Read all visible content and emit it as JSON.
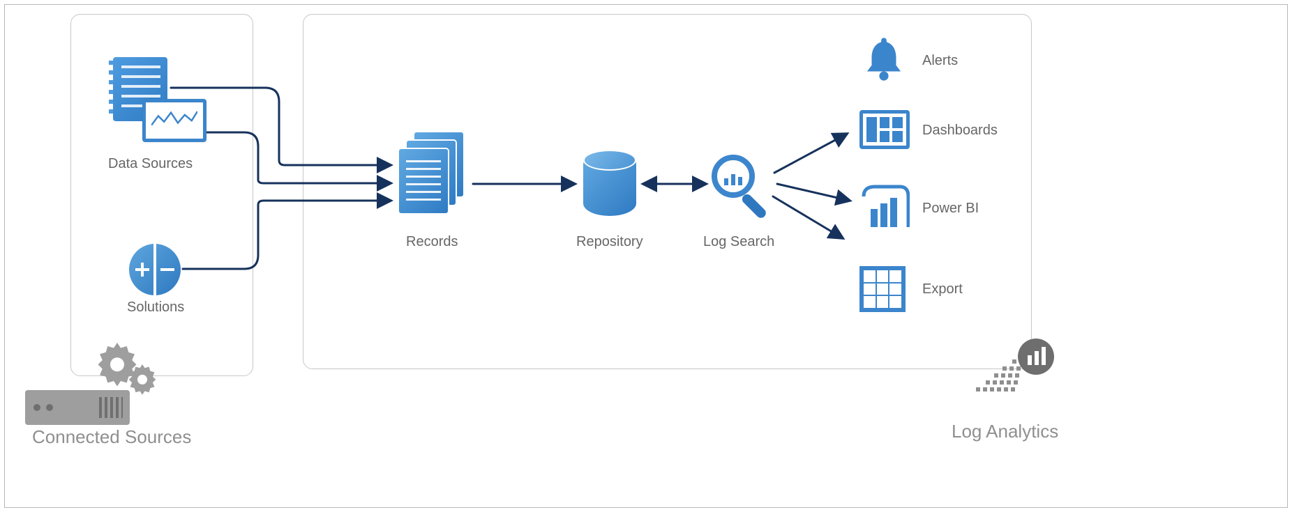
{
  "sources_panel": {
    "data_sources_label": "Data Sources",
    "solutions_label": "Solutions",
    "connected_sources_label": "Connected Sources"
  },
  "pipeline": {
    "records_label": "Records",
    "repository_label": "Repository",
    "log_search_label": "Log Search"
  },
  "outputs": {
    "alerts_label": "Alerts",
    "dashboards_label": "Dashboards",
    "powerbi_label": "Power BI",
    "export_label": "Export"
  },
  "branding": {
    "log_analytics_label": "Log Analytics"
  },
  "colors": {
    "primary_blue": "#3b85cc",
    "dark_navy": "#16325c",
    "grey": "#9e9e9e"
  }
}
